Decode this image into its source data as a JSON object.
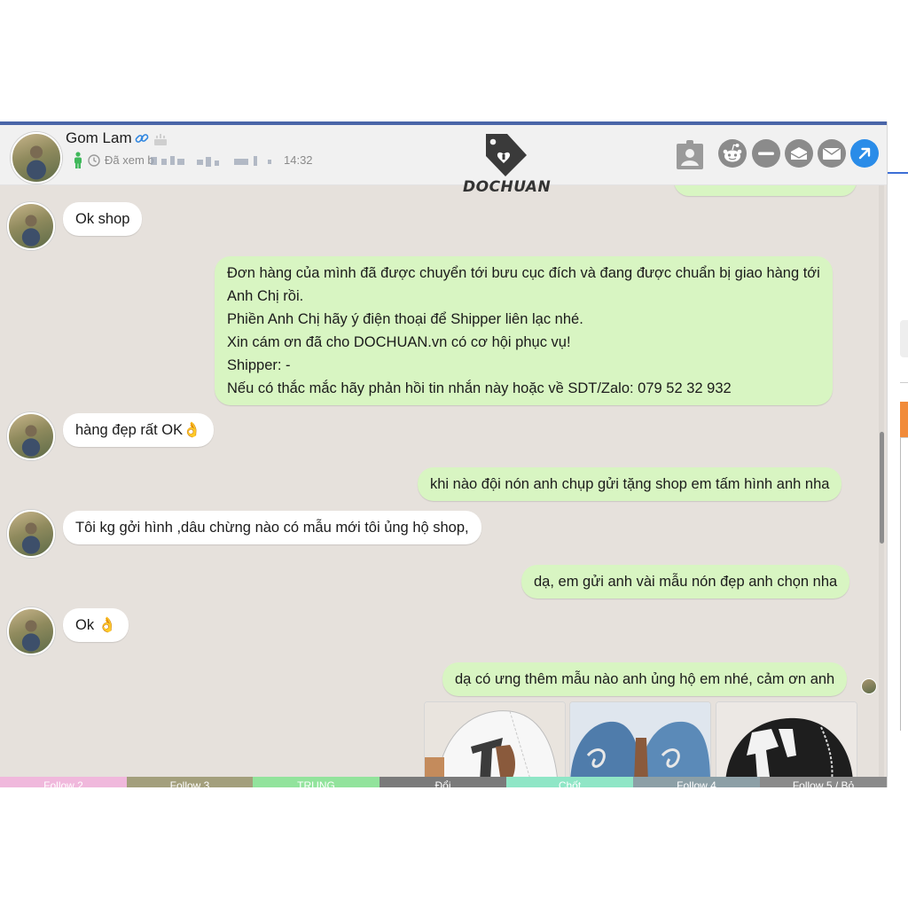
{
  "header": {
    "name": "Gom Lam",
    "seen_label": "Đã xem b",
    "time": "14:32",
    "logo_text": "DOCHUAN"
  },
  "messages": [
    {
      "side": "in",
      "text": "Ok shop"
    },
    {
      "side": "out",
      "lines": [
        "Đơn hàng của mình đã được chuyển tới bưu cục đích và đang được chuẩn bị giao hàng tới",
        "Anh Chị rồi.",
        "Phiền Anh Chị hãy ý điện thoại để Shipper liên lạc nhé.",
        "Xin cám ơn đã cho DOCHUAN.vn có cơ hội phục vụ!",
        "Shipper: -",
        "Nếu có thắc mắc hãy phản hồi tin nhắn này hoặc về SDT/Zalo: 079 52 32 932"
      ]
    },
    {
      "side": "in",
      "text": "hàng đẹp rất OK👌"
    },
    {
      "side": "out",
      "text": "khi nào đội nón anh chụp gửi tặng shop em tấm hình anh nha"
    },
    {
      "side": "in",
      "text": "Tôi kg gởi hình ,dâu chừng nào có mẫu mới tôi ủng hộ shop,"
    },
    {
      "side": "out",
      "text": "dạ, em gửi anh vài mẫu nón đẹp anh chọn nha"
    },
    {
      "side": "in",
      "text": "Ok 👌"
    },
    {
      "side": "out",
      "text": "dạ có ưng thêm mẫu nào anh ủng hộ em nhé, cảm ơn anh"
    }
  ],
  "photos": [
    {
      "name": "white-cap",
      "color": "#f2f2f2"
    },
    {
      "name": "denim-cap",
      "color": "#5b86b4"
    },
    {
      "name": "black-cap",
      "color": "#1c1c1c"
    }
  ],
  "tabs": [
    {
      "label": "Follow 2",
      "color": "#f0b8dc"
    },
    {
      "label": "Follow 3",
      "color": "#a39f7c"
    },
    {
      "label": "TRUNG",
      "color": "#92e39c"
    },
    {
      "label": "Đổi",
      "color": "#7a7a7a"
    },
    {
      "label": "Chốt",
      "color": "#8fe6c6"
    },
    {
      "label": "Follow 4",
      "color": "#8c9fa6"
    },
    {
      "label": "Follow 5 / Bỏ",
      "color": "#8a8a8a"
    }
  ],
  "colors": {
    "incoming_bubble": "#ffffff",
    "outgoing_bubble": "#d8f5c2",
    "chat_background": "#e6e1dc",
    "accent_blue": "#2a8ce8",
    "top_bar": "#4a66a8"
  },
  "icons": [
    "link-icon",
    "cake-icon",
    "person-icon",
    "clock-icon",
    "contact-card-icon",
    "reddit-icon",
    "minus-icon",
    "inbox-icon",
    "mail-icon",
    "open-external-icon"
  ]
}
